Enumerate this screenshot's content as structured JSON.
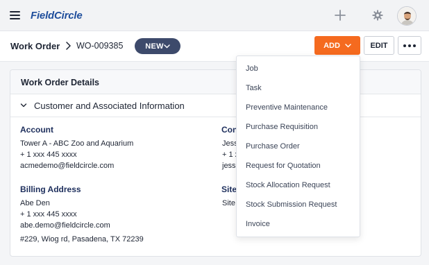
{
  "header": {
    "logo": "FieldCircle",
    "icons": [
      "menu-icon",
      "plus-icon",
      "gear-icon",
      "avatar"
    ]
  },
  "breadcrumb": {
    "title": "Work Order",
    "id": "WO-009385",
    "status": "NEW"
  },
  "toolbar": {
    "add_label": "ADD",
    "edit_label": "EDIT"
  },
  "card": {
    "title": "Work Order Details",
    "section_title": "Customer and Associated Information",
    "account": {
      "title": "Account",
      "lines": [
        "Tower A - ABC Zoo and Aquarium",
        "+ 1 xxx 445 xxxx",
        "acmedemo@fieldcircle.com"
      ]
    },
    "contact": {
      "title": "Con",
      "lines": [
        "Jess",
        "+ 1 x",
        "jess"
      ]
    },
    "billing": {
      "title": "Billing Address",
      "lines": [
        "Abe Den",
        "+ 1 xxx 445 xxxx",
        "abe.demo@fieldcircle.com",
        "#229, Wiog rd, Pasadena, TX 72239"
      ]
    },
    "site": {
      "title": "Site",
      "lines": [
        "Site"
      ]
    }
  },
  "add_menu": {
    "items": [
      "Job",
      "Task",
      "Preventive Maintenance",
      "Purchase Requisition",
      "Purchase Order",
      "Request for Quotation",
      "Stock Allocation Request",
      "Stock Submission Request",
      "Invoice"
    ]
  },
  "colors": {
    "accent": "#f56a1f",
    "badge": "#3d4a6b",
    "logo": "#1f4e9c",
    "heading": "#1d2e5c"
  }
}
